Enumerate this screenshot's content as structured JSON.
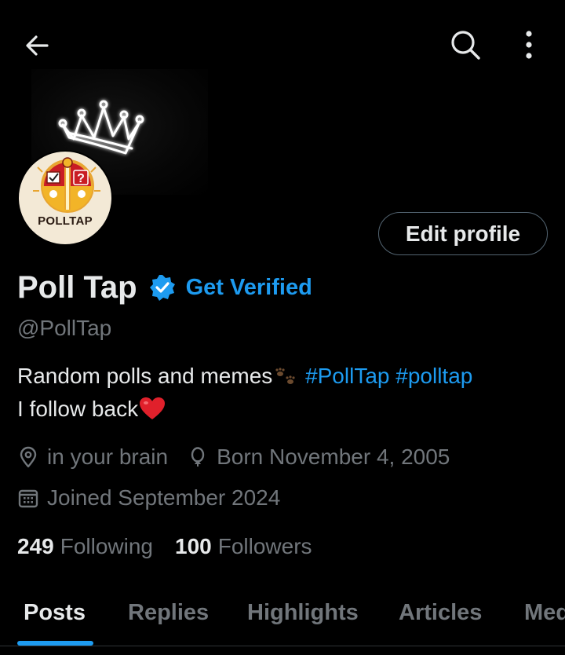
{
  "header": {
    "back_icon": "arrow-left-icon",
    "search_icon": "search-icon",
    "more_icon": "more-vertical-icon"
  },
  "banner": {
    "icon": "crown-icon"
  },
  "avatar": {
    "text": "POLLTAP"
  },
  "edit_profile_label": "Edit profile",
  "profile": {
    "name": "Poll Tap",
    "get_verified_label": "Get Verified",
    "handle": "@PollTap",
    "bio": {
      "line1_text": "Random polls and memes",
      "hashtag1": "#PollTap",
      "hashtag2": "#polltap",
      "line2_text": "I follow back"
    },
    "location": "in your brain",
    "birthday": "Born November 4, 2005",
    "joined": "Joined September 2024"
  },
  "stats": {
    "following_count": "249",
    "following_label": "Following",
    "followers_count": "100",
    "followers_label": "Followers"
  },
  "tabs": [
    {
      "label": "Posts",
      "active": true
    },
    {
      "label": "Replies"
    },
    {
      "label": "Highlights"
    },
    {
      "label": "Articles"
    },
    {
      "label": "Media"
    }
  ],
  "colors": {
    "background": "#000000",
    "accent": "#1d9bf0",
    "text_primary": "#e7e9ea",
    "text_secondary": "#71767b"
  }
}
